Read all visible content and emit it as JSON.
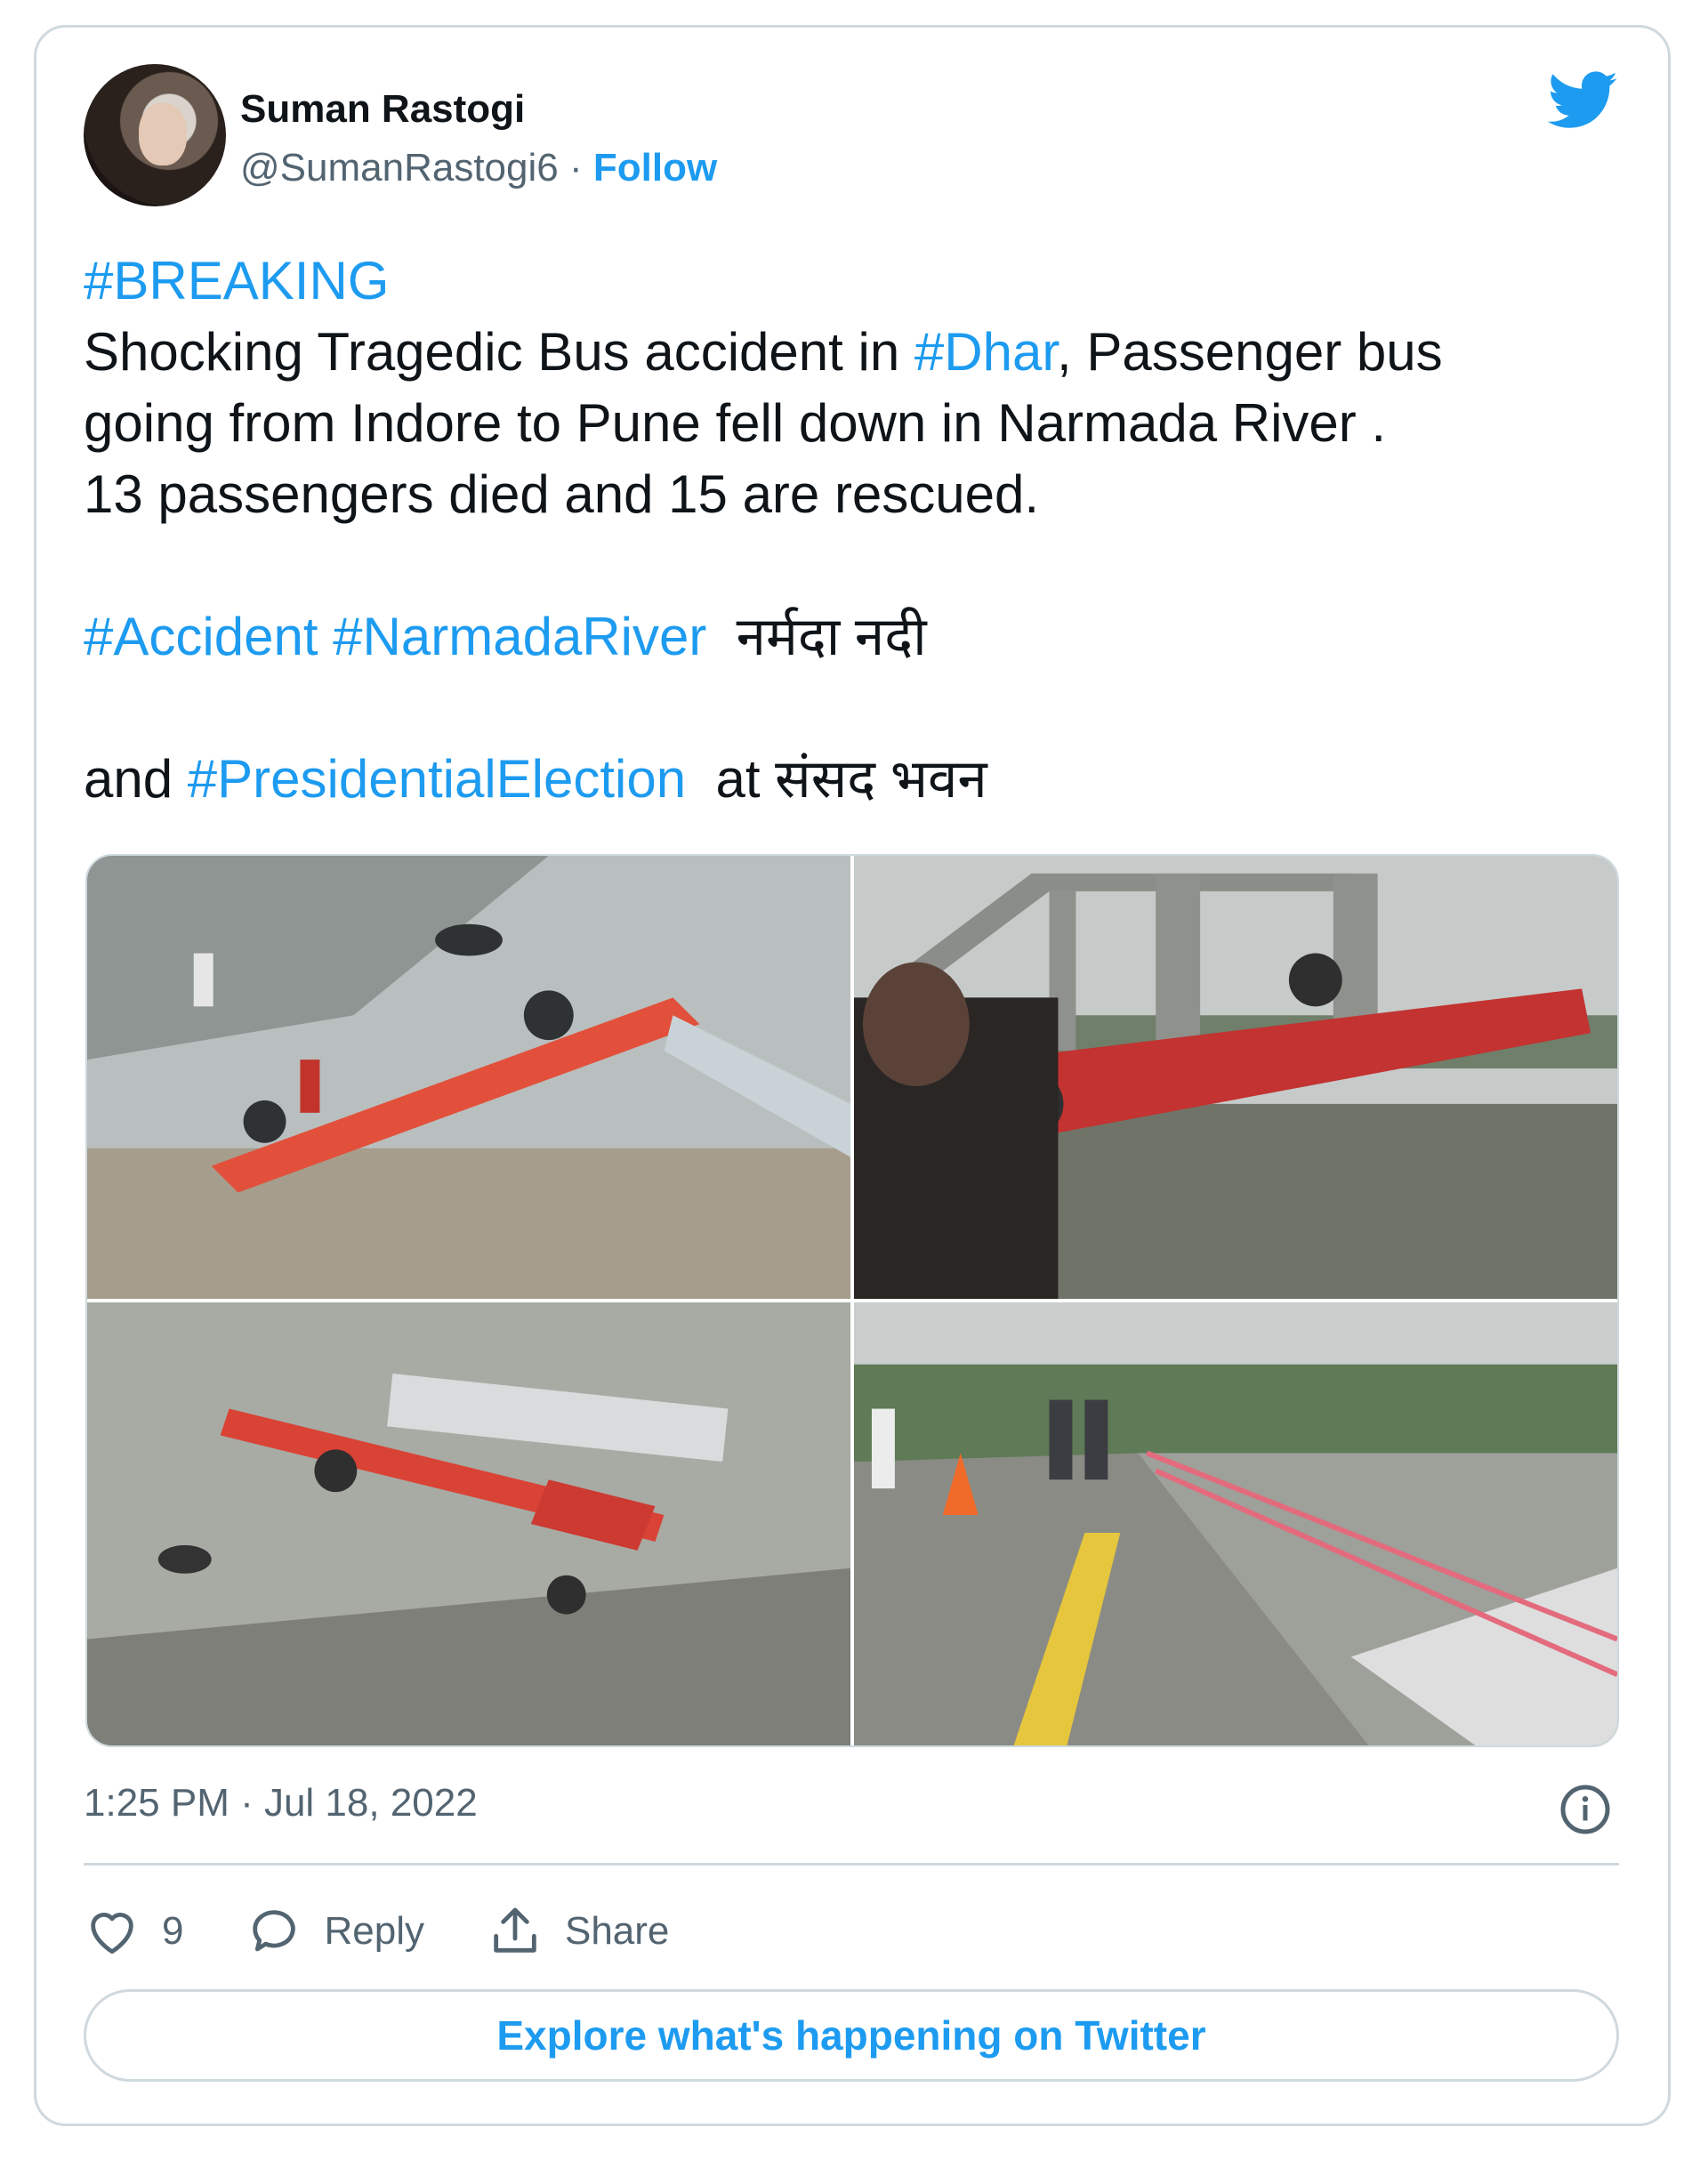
{
  "user": {
    "name": "Suman Rastogi",
    "handle": "@SumanRastogi6",
    "separator": " · ",
    "follow_label": "Follow"
  },
  "tweet": {
    "line1_tag": "#BREAKING",
    "line2_pre": "Shocking Tragedic Bus accident in ",
    "line2_tag": "#Dhar",
    "line2_post": ", Passenger bus",
    "line3": "going from Indore to Pune fell down in Narmada River .",
    "line4": "13 passengers died and 15 are rescued.",
    "line5_tag1": "#Accident",
    "line5_tag2": "#NarmadaRiver",
    "line5_post": "  नर्मदा नदी",
    "line6_pre": "and ",
    "line6_tag": "#PresidentialElection",
    "line6_post": "  at संसद भवन"
  },
  "media": {
    "photos": [
      "bus-in-river-aerial",
      "overturned-bus-under-bridge",
      "bus-wreck-in-water",
      "damaged-bridge-railing"
    ]
  },
  "meta": {
    "timestamp": "1:25 PM · Jul 18, 2022"
  },
  "actions": {
    "like_count": "9",
    "reply_label": "Reply",
    "share_label": "Share"
  },
  "footer": {
    "explore_label": "Explore what's happening on Twitter"
  },
  "colors": {
    "accent": "#1d9bf0",
    "text": "#0f1419",
    "muted": "#536471",
    "border": "#cfd9de"
  },
  "icons": [
    "twitter-bird-icon",
    "info-icon",
    "heart-icon",
    "reply-bubble-icon",
    "share-icon"
  ]
}
